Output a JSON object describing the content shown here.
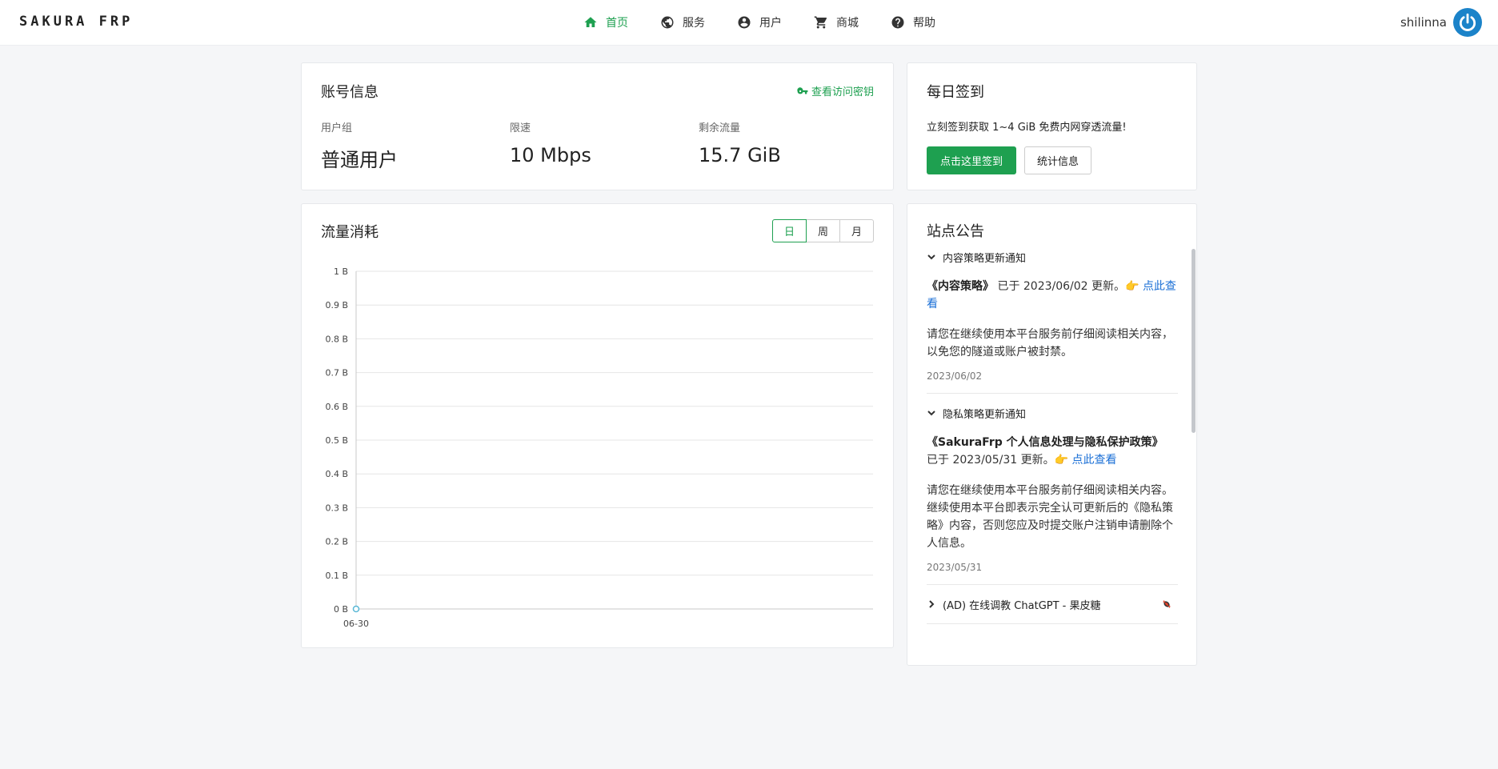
{
  "brand": "SAKURA FRP",
  "nav": [
    {
      "label": "首页",
      "icon": "home-icon",
      "active": true
    },
    {
      "label": "服务",
      "icon": "globe-icon",
      "active": false
    },
    {
      "label": "用户",
      "icon": "user-circle-icon",
      "active": false
    },
    {
      "label": "商城",
      "icon": "cart-icon",
      "active": false
    },
    {
      "label": "帮助",
      "icon": "help-icon",
      "active": false
    }
  ],
  "user": {
    "name": "shilinna",
    "avatar_icon": "power-icon"
  },
  "account": {
    "title": "账号信息",
    "key_link": "查看访问密钥",
    "stats": [
      {
        "label": "用户组",
        "value": "普通用户"
      },
      {
        "label": "限速",
        "value": "10 Mbps"
      },
      {
        "label": "剩余流量",
        "value": "15.7 GiB"
      }
    ]
  },
  "checkin": {
    "title": "每日签到",
    "desc": "立刻签到获取 1~4 GiB 免费内网穿透流量!",
    "primary_btn": "点击这里签到",
    "secondary_btn": "统计信息"
  },
  "traffic": {
    "title": "流量消耗",
    "tabs": [
      "日",
      "周",
      "月"
    ],
    "active_tab": 0
  },
  "chart_data": {
    "type": "line",
    "x": [
      "06-30"
    ],
    "series": [
      {
        "values": [
          0
        ]
      }
    ],
    "yticks": [
      "0 B",
      "0.1 B",
      "0.2 B",
      "0.3 B",
      "0.4 B",
      "0.5 B",
      "0.6 B",
      "0.7 B",
      "0.8 B",
      "0.9 B",
      "1 B"
    ],
    "ylim": [
      0,
      1
    ],
    "grid": true,
    "color": "#5ab8d6"
  },
  "notices": {
    "title": "站点公告",
    "items": [
      {
        "heading": "内容策略更新通知",
        "p1_bold": "《内容策略》",
        "p1_text": " 已于 2023/06/02 更新。👉 ",
        "p1_link": "点此查看",
        "p2": "请您在继续使用本平台服务前仔细阅读相关内容，以免您的隧道或账户被封禁。",
        "date": "2023/06/02"
      },
      {
        "heading": "隐私策略更新通知",
        "p1_bold": "《SakuraFrp 个人信息处理与隐私保护政策》",
        "p1_text": "已于 2023/05/31 更新。👉 ",
        "p1_link": "点此查看",
        "p2": "请您在继续使用本平台服务前仔细阅读相关内容。继续使用本平台即表示完全认可更新后的《隐私策略》内容，否则您应及时提交账户注销申请删除个人信息。",
        "date": "2023/05/31"
      }
    ],
    "ad": {
      "heading": "(AD) 在线调教 ChatGPT - 果皮糖",
      "icon": "candy-icon"
    }
  }
}
